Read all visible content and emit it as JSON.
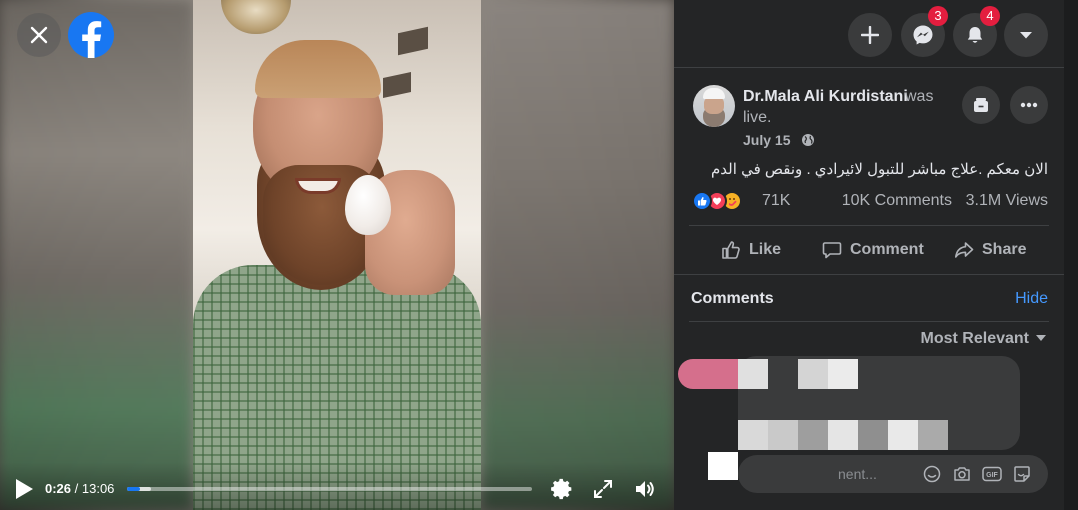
{
  "video": {
    "current_time": "0:26",
    "separator": " / ",
    "duration": "13:06",
    "progress": 0.033,
    "buffered": 0.06
  },
  "topbar": {
    "messenger_badge": "3",
    "notifications_badge": "4"
  },
  "post": {
    "author": "Dr.Mala Ali Kurdistani",
    "was_live_1": "was",
    "was_live_2": "live.",
    "date": "July 15",
    "text": "الان معكم .علاج مباشر للتبول لائيرادي . ونقص في الدم",
    "reactions_count": "71K",
    "comments_count": "10K Comments",
    "views_count": "3.1M Views"
  },
  "actions": {
    "like": "Like",
    "comment": "Comment",
    "share": "Share"
  },
  "comments": {
    "title": "Comments",
    "hide": "Hide",
    "sort": "Most Relevant",
    "input_placeholder_fragment": "nent..."
  },
  "colors": {
    "facebook_blue": "#1877f2",
    "panel_bg": "#242526",
    "badge_red": "#e41e3f",
    "link_blue": "#4599ff"
  }
}
